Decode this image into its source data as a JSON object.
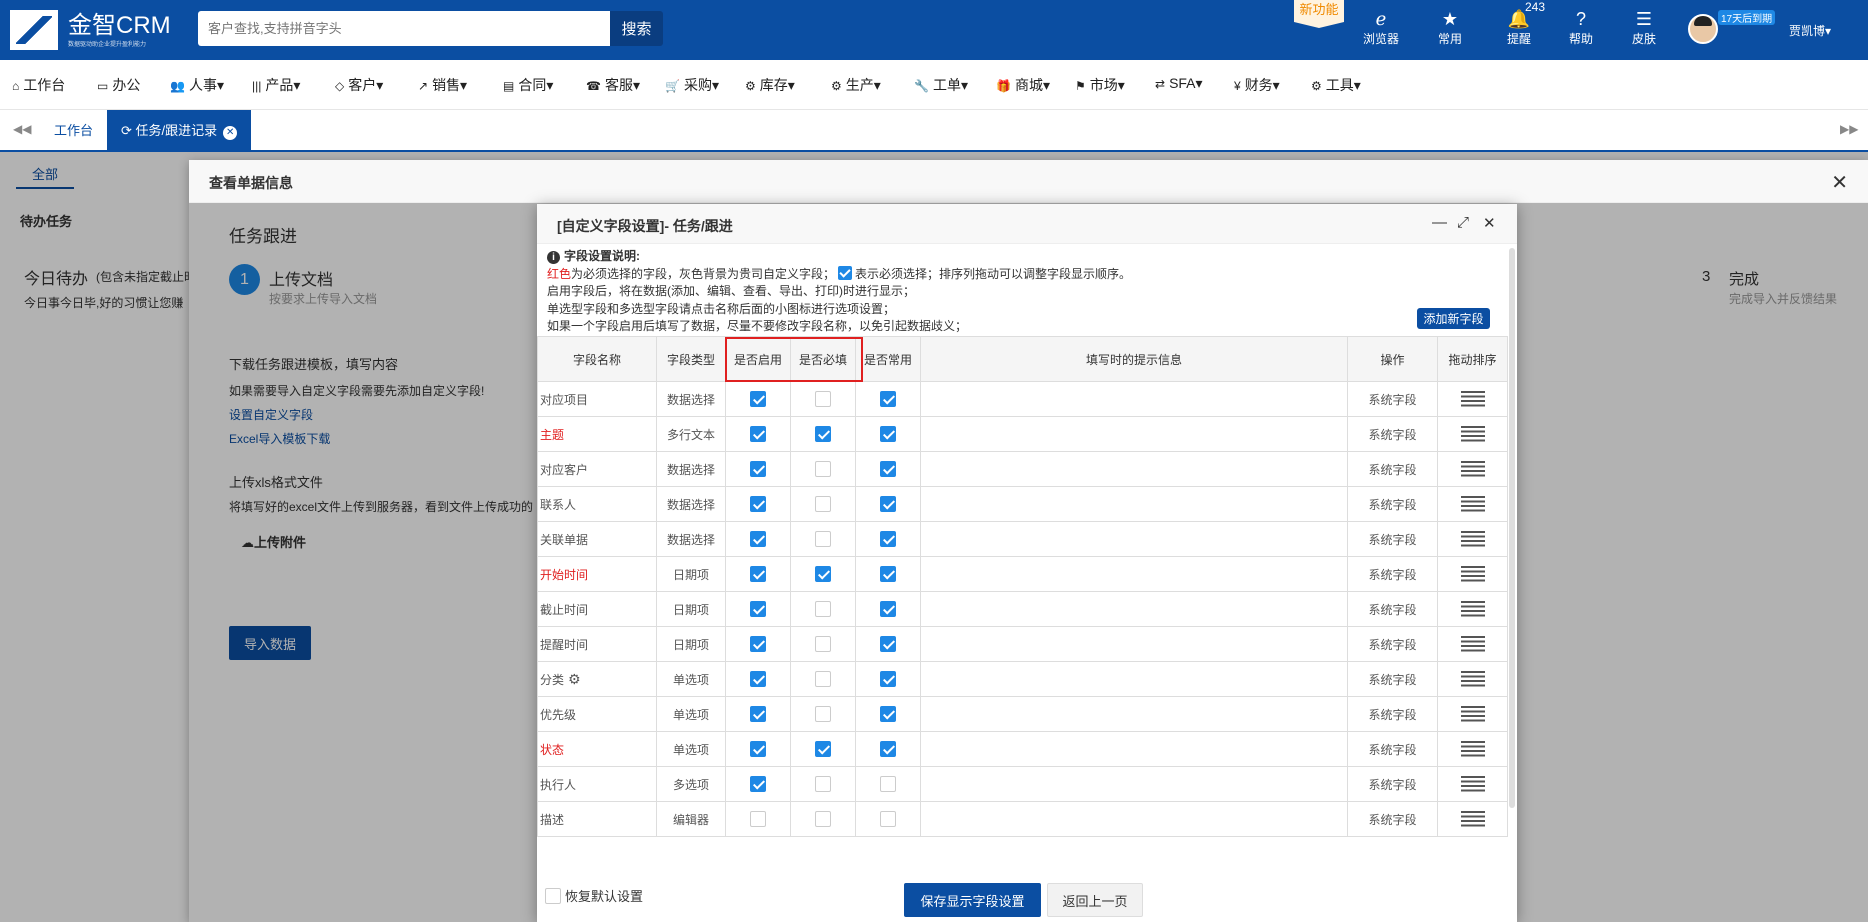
{
  "header": {
    "brand": "金智CRM",
    "brand_sub": "数据驱动助企业提升盈利能力",
    "search_placeholder": "客户查找,支持拼音字头",
    "search_button": "搜索",
    "new_feature": "新功能",
    "icons": [
      {
        "label": "浏览器",
        "icon": "ie-icon"
      },
      {
        "label": "常用",
        "icon": "star-icon"
      },
      {
        "label": "提醒",
        "icon": "bell-icon",
        "badge": "243"
      },
      {
        "label": "帮助",
        "icon": "help-icon"
      },
      {
        "label": "皮肤",
        "icon": "skin-icon"
      }
    ],
    "trial_badge": "17天后到期",
    "user_name": "贾凯博▾"
  },
  "menu": [
    {
      "icon": "⌂",
      "label": "工作台"
    },
    {
      "icon": "▭",
      "label": "办公"
    },
    {
      "icon": "👥",
      "label": "人事▾"
    },
    {
      "icon": "|||",
      "label": "产品▾"
    },
    {
      "icon": "◇",
      "label": "客户▾"
    },
    {
      "icon": "↗",
      "label": "销售▾"
    },
    {
      "icon": "▤",
      "label": "合同▾"
    },
    {
      "icon": "☎",
      "label": "客服▾"
    },
    {
      "icon": "🛒",
      "label": "采购▾"
    },
    {
      "icon": "⚙",
      "label": "库存▾"
    },
    {
      "icon": "⚙",
      "label": "生产▾"
    },
    {
      "icon": "🔧",
      "label": "工单▾"
    },
    {
      "icon": "🎁",
      "label": "商城▾"
    },
    {
      "icon": "⚑",
      "label": "市场▾"
    },
    {
      "icon": "⇄",
      "label": "SFA▾"
    },
    {
      "icon": "¥",
      "label": "财务▾"
    },
    {
      "icon": "⚙",
      "label": "工具▾"
    }
  ],
  "tabs": {
    "workbench": "工作台",
    "active": "任务/跟进记录"
  },
  "background": {
    "tab_all": "全部",
    "todo": "待办任务",
    "today": "今日待办",
    "today_note": "(包含未指定截止时",
    "slogan": "今日事今日毕,好的习惯让您赚"
  },
  "outer": {
    "title": "查看单据信息",
    "section": "任务跟进",
    "step1_num": "1",
    "step1_title": "上传文档",
    "step1_sub": "按要求上传导入文档",
    "step3_num": "3",
    "step3_title": "完成",
    "step3_sub": "完成导入并反馈结果",
    "download_title": "下载任务跟进模板，填写内容",
    "download_note": "如果需要导入自定义字段需要先添加自定义字段!",
    "link_custom": "设置自定义字段",
    "link_template": "Excel导入模板下载",
    "upload_title": "上传xls格式文件",
    "upload_note": "将填写好的excel文件上传到服务器，看到文件上传成功的",
    "upload_attach": "上传附件",
    "import_button": "导入数据"
  },
  "inner": {
    "title": "[自定义字段设置]- 任务/跟进",
    "notes_title": "字段设置说明:",
    "note1_red": "红色",
    "note1_a": "为必须选择的字段，灰色背景为贵司自定义字段；",
    "note1_b": "表示必须选择；排序列拖动可以调整字段显示顺序。",
    "note2": "启用字段后，将在数据(添加、编辑、查看、导出、打印)时进行显示；",
    "note3": "单选型字段和多选型字段请点击名称后面的小图标进行选项设置；",
    "note4": "如果一个字段启用后填写了数据，尽量不要修改字段名称，以免引起数据歧义；",
    "add_field": "添加新字段",
    "columns": [
      "字段名称",
      "字段类型",
      "是否启用",
      "是否必填",
      "是否常用",
      "填写时的提示信息",
      "操作",
      "拖动排序"
    ],
    "rows": [
      {
        "name": "对应项目",
        "type": "数据选择",
        "enabled": true,
        "required": false,
        "common": true,
        "hint": "",
        "op": "系统字段",
        "red": false
      },
      {
        "name": "主题",
        "type": "多行文本",
        "enabled": true,
        "required": true,
        "common": true,
        "hint": "",
        "op": "系统字段",
        "red": true
      },
      {
        "name": "对应客户",
        "type": "数据选择",
        "enabled": true,
        "required": false,
        "common": true,
        "hint": "",
        "op": "系统字段",
        "red": false
      },
      {
        "name": "联系人",
        "type": "数据选择",
        "enabled": true,
        "required": false,
        "common": true,
        "hint": "",
        "op": "系统字段",
        "red": false
      },
      {
        "name": "关联单据",
        "type": "数据选择",
        "enabled": true,
        "required": false,
        "common": true,
        "hint": "",
        "op": "系统字段",
        "red": false
      },
      {
        "name": "开始时间",
        "type": "日期项",
        "enabled": true,
        "required": true,
        "common": true,
        "hint": "",
        "op": "系统字段",
        "red": true
      },
      {
        "name": "截止时间",
        "type": "日期项",
        "enabled": true,
        "required": false,
        "common": true,
        "hint": "",
        "op": "系统字段",
        "red": false
      },
      {
        "name": "提醒时间",
        "type": "日期项",
        "enabled": true,
        "required": false,
        "common": true,
        "hint": "",
        "op": "系统字段",
        "red": false
      },
      {
        "name": "分类",
        "type": "单选项",
        "enabled": true,
        "required": false,
        "common": true,
        "hint": "",
        "op": "系统字段",
        "red": false,
        "gear": true
      },
      {
        "name": "优先级",
        "type": "单选项",
        "enabled": true,
        "required": false,
        "common": true,
        "hint": "",
        "op": "系统字段",
        "red": false
      },
      {
        "name": "状态",
        "type": "单选项",
        "enabled": true,
        "required": true,
        "common": true,
        "hint": "",
        "op": "系统字段",
        "red": true
      },
      {
        "name": "执行人",
        "type": "多选项",
        "enabled": true,
        "required": false,
        "common": false,
        "hint": "",
        "op": "系统字段",
        "red": false
      },
      {
        "name": "描述",
        "type": "编辑器",
        "enabled": false,
        "required": false,
        "common": false,
        "hint": "",
        "op": "系统字段",
        "red": false
      }
    ],
    "restore": "恢复默认设置",
    "save": "保存显示字段设置",
    "back": "返回上一页"
  },
  "colors": {
    "primary": "#0b4ea2",
    "check": "#1e88e5",
    "required_red": "#e02020"
  }
}
